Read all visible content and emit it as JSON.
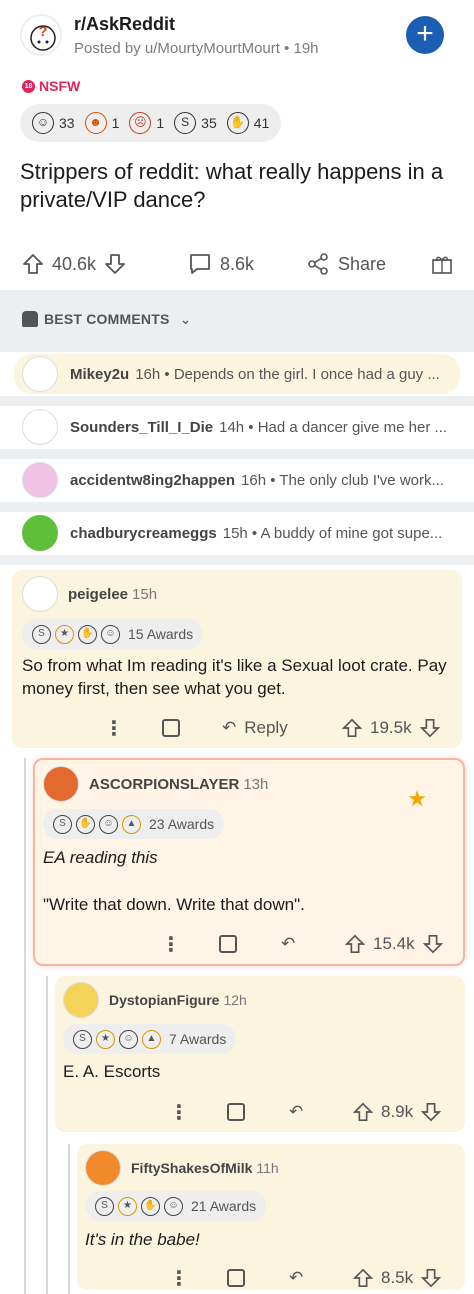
{
  "header": {
    "subreddit": "r/AskReddit",
    "posted_by": "Posted by u/MourtyMourtMourt • 19h",
    "nsfw": "NSFW",
    "nsfw_badge": "18",
    "create_icon": "plus-icon"
  },
  "post_awards": [
    {
      "icon": "grin-icon",
      "count": "33"
    },
    {
      "icon": "face-icon",
      "count": "1"
    },
    {
      "icon": "face-icon",
      "count": "1"
    },
    {
      "icon": "silver-icon",
      "count": "35"
    },
    {
      "icon": "hands-icon",
      "count": "41"
    }
  ],
  "post": {
    "title": "Strippers of reddit: what really happens in a private/VIP dance?",
    "upvotes": "40.6k",
    "comments": "8.6k",
    "share": "Share"
  },
  "best_comments": {
    "label": "BEST COMMENTS",
    "previews": [
      {
        "user": "Mikey2u",
        "text": "16h • Depends on the girl. I once had a guy ..."
      },
      {
        "user": "Sounders_Till_I_Die",
        "text": "14h • Had a dancer give me her ..."
      },
      {
        "user": "accidentw8ing2happen",
        "text": "16h • The only club I've work..."
      },
      {
        "user": "chadburycreameggs",
        "text": "15h • A buddy of mine got supe..."
      }
    ]
  },
  "thread": [
    {
      "user": "peigelee",
      "time": "15h",
      "awards": "15 Awards",
      "body": "So from what Im reading it's like a Sexual loot crate. Pay money first, then see what you get.",
      "reply": "Reply",
      "score": "19.5k"
    },
    {
      "user": "ASCORPIONSLAYER",
      "time": "13h",
      "awards": "23 Awards",
      "body1": "EA reading this",
      "body2": "\"Write that down. Write that down\".",
      "score": "15.4k"
    },
    {
      "user": "DystopianFigure",
      "time": "12h",
      "awards": "7 Awards",
      "body": "E. A. Escorts",
      "score": "8.9k"
    },
    {
      "user": "FiftyShakesOfMilk",
      "time": "11h",
      "awards": "21 Awards",
      "body": "It's in the babe!",
      "score": "8.5k"
    }
  ]
}
